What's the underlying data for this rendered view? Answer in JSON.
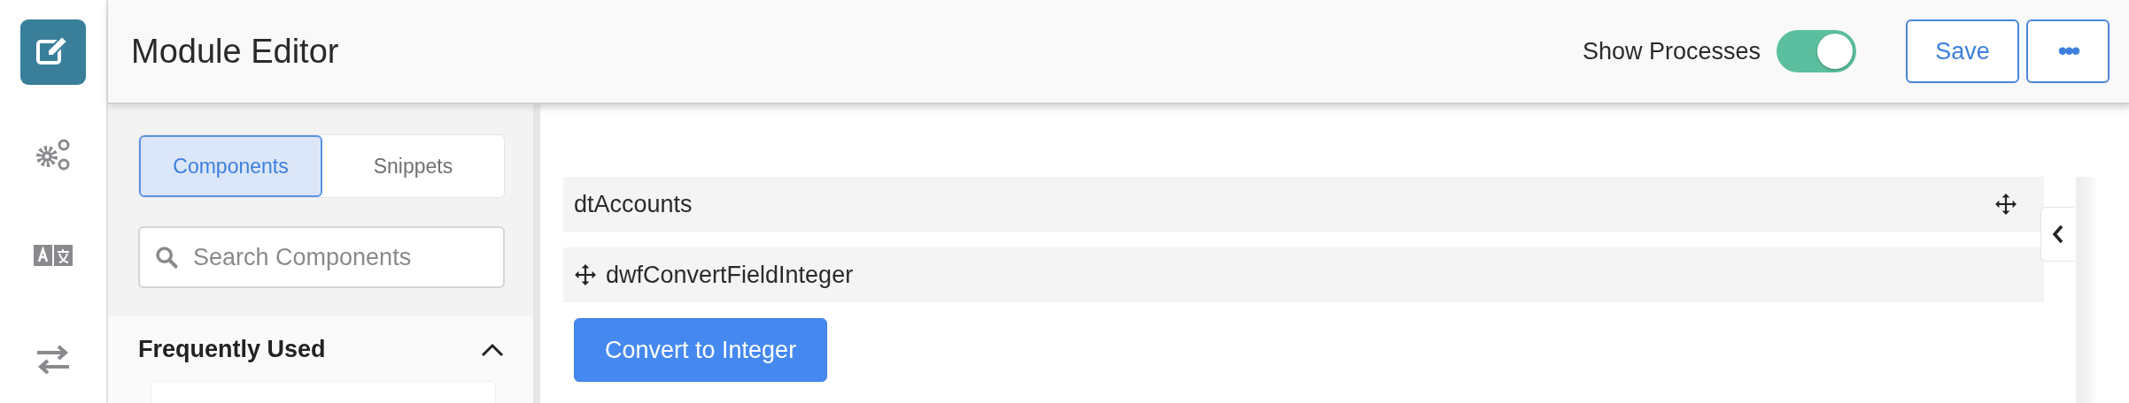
{
  "rail": {
    "items": [
      {
        "kind": "edit",
        "selected": true
      },
      {
        "kind": "gears",
        "selected": false
      },
      {
        "kind": "translate",
        "selected": false
      },
      {
        "kind": "transfer",
        "selected": false
      }
    ]
  },
  "header": {
    "title": "Module Editor",
    "toggle": {
      "label": "Show Processes",
      "on": true
    },
    "buttons": [
      {
        "kind": "text",
        "label": "Save"
      },
      {
        "kind": "more",
        "label": "•••"
      }
    ]
  },
  "panel": {
    "tabs": [
      {
        "label": "Components",
        "selected": true
      },
      {
        "label": "Snippets",
        "selected": false
      }
    ],
    "search": {
      "placeholder": "Search Components"
    },
    "section": {
      "title": "Frequently Used",
      "expanded": true
    }
  },
  "canvas": {
    "rows": [
      {
        "label": "dtAccounts",
        "kind": "trailing"
      },
      {
        "label": "dwfConvertFieldInteger",
        "kind": "leading"
      }
    ],
    "button": {
      "label": "Convert to Integer"
    }
  }
}
